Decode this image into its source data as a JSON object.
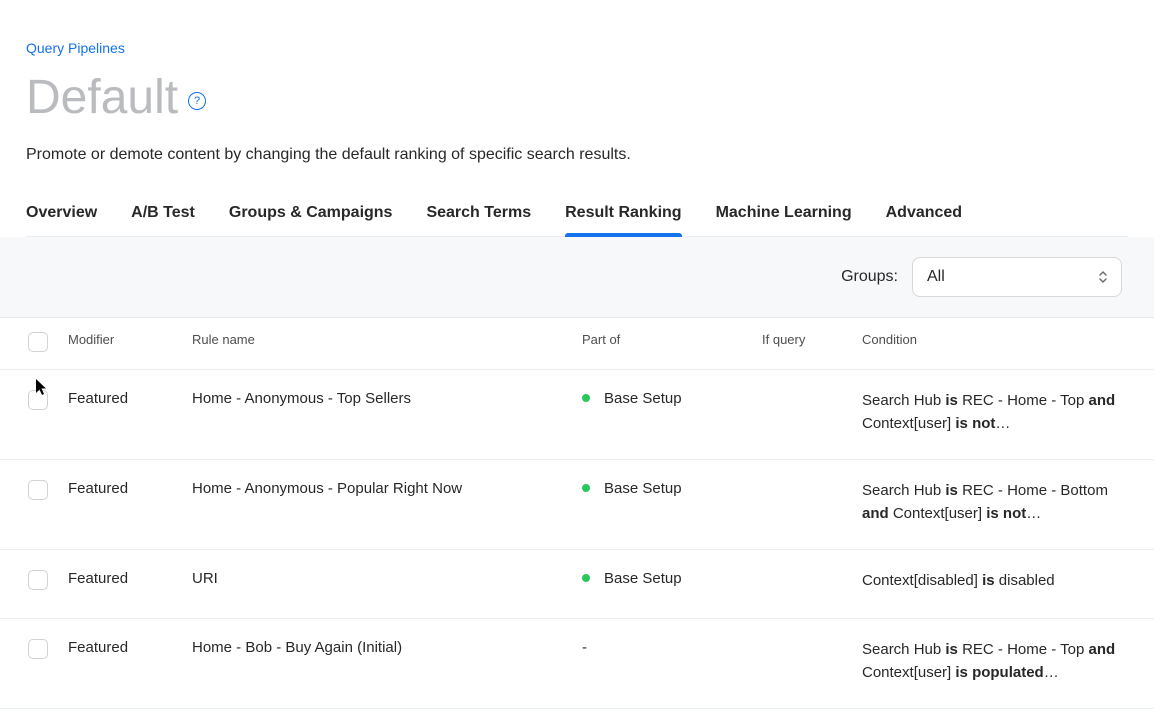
{
  "breadcrumb": "Query Pipelines",
  "title": "Default",
  "help_tooltip": "?",
  "subtitle": "Promote or demote content by changing the default ranking of specific search results.",
  "tabs": [
    {
      "id": "overview",
      "label": "Overview",
      "active": false
    },
    {
      "id": "abtest",
      "label": "A/B Test",
      "active": false
    },
    {
      "id": "groups",
      "label": "Groups & Campaigns",
      "active": false
    },
    {
      "id": "terms",
      "label": "Search Terms",
      "active": false
    },
    {
      "id": "ranking",
      "label": "Result Ranking",
      "active": true
    },
    {
      "id": "ml",
      "label": "Machine Learning",
      "active": false
    },
    {
      "id": "advanced",
      "label": "Advanced",
      "active": false
    }
  ],
  "controls": {
    "groups_label": "Groups:",
    "groups_selected": "All"
  },
  "columns": {
    "modifier": "Modifier",
    "rule_name": "Rule name",
    "part_of": "Part of",
    "if_query": "If query",
    "condition": "Condition"
  },
  "rows": [
    {
      "modifier": "Featured",
      "rule_name": "Home - Anonymous - Top Sellers",
      "part_of": "Base Setup",
      "has_dot": true,
      "if_query": "",
      "condition_segments": [
        {
          "t": "Search Hub",
          "kw": false
        },
        {
          "t": " is ",
          "kw": true
        },
        {
          "t": "REC - Home - Top",
          "kw": false
        },
        {
          "t": " and ",
          "kw": true
        },
        {
          "t": "Context[user]",
          "kw": false
        },
        {
          "t": " is not",
          "kw": true
        },
        {
          "t": "…",
          "kw": false
        }
      ]
    },
    {
      "modifier": "Featured",
      "rule_name": "Home - Anonymous - Popular Right Now",
      "part_of": "Base Setup",
      "has_dot": true,
      "if_query": "",
      "condition_segments": [
        {
          "t": "Search Hub",
          "kw": false
        },
        {
          "t": " is ",
          "kw": true
        },
        {
          "t": "REC - Home - Bottom",
          "kw": false
        },
        {
          "t": " and ",
          "kw": true
        },
        {
          "t": "Context[user]",
          "kw": false
        },
        {
          "t": " is not",
          "kw": true
        },
        {
          "t": "…",
          "kw": false
        }
      ]
    },
    {
      "modifier": "Featured",
      "rule_name": "URI",
      "part_of": "Base Setup",
      "has_dot": true,
      "if_query": "",
      "condition_segments": [
        {
          "t": "Context[disabled]",
          "kw": false
        },
        {
          "t": " is ",
          "kw": true
        },
        {
          "t": "disabled",
          "kw": false
        }
      ]
    },
    {
      "modifier": "Featured",
      "rule_name": "Home - Bob - Buy Again (Initial)",
      "part_of": "-",
      "has_dot": false,
      "if_query": "",
      "condition_segments": [
        {
          "t": "Search Hub",
          "kw": false
        },
        {
          "t": " is ",
          "kw": true
        },
        {
          "t": "REC - Home - Top",
          "kw": false
        },
        {
          "t": " and ",
          "kw": true
        },
        {
          "t": "Context[user]",
          "kw": false
        },
        {
          "t": " is populated",
          "kw": true
        },
        {
          "t": "…",
          "kw": false
        }
      ]
    }
  ]
}
